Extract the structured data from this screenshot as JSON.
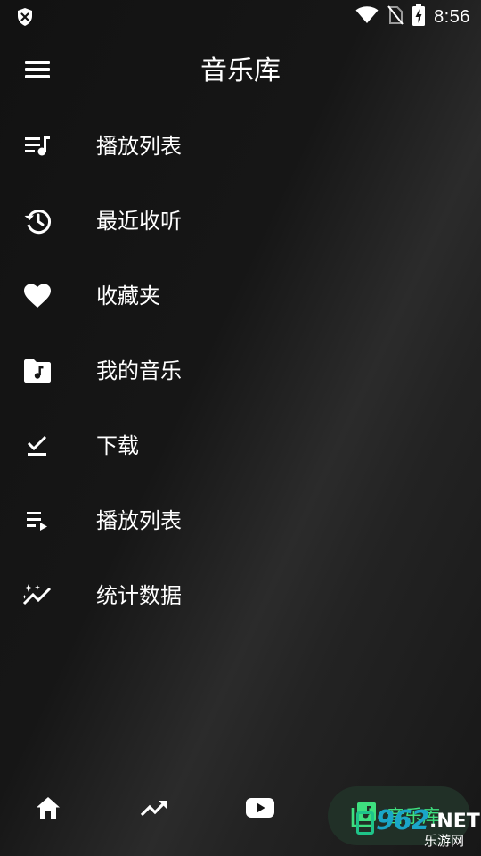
{
  "status_bar": {
    "time": "8:56",
    "icons": [
      "shield-icon",
      "wifi-icon",
      "no-sim-icon",
      "battery-charging-icon"
    ]
  },
  "header": {
    "title": "音乐库",
    "menu_icon": "menu-icon"
  },
  "menu": {
    "items": [
      {
        "label": "播放列表",
        "icon": "playlist-music-icon"
      },
      {
        "label": "最近收听",
        "icon": "history-icon"
      },
      {
        "label": "收藏夹",
        "icon": "heart-icon"
      },
      {
        "label": "我的音乐",
        "icon": "music-folder-icon"
      },
      {
        "label": "下载",
        "icon": "download-done-icon"
      },
      {
        "label": "播放列表",
        "icon": "playlist-play-icon"
      },
      {
        "label": "统计数据",
        "icon": "stats-icon"
      }
    ]
  },
  "bottom_nav": {
    "items": [
      {
        "icon": "home-icon"
      },
      {
        "icon": "trending-icon"
      },
      {
        "icon": "youtube-icon"
      }
    ],
    "active": {
      "label": "音乐库",
      "icon": "library-music-icon"
    }
  },
  "watermark": {
    "number": "962",
    "suffix": ".NET",
    "sub": "乐游网"
  },
  "colors": {
    "background": "#141414",
    "accent": "#3ee07f",
    "active_pill": "#213027"
  }
}
